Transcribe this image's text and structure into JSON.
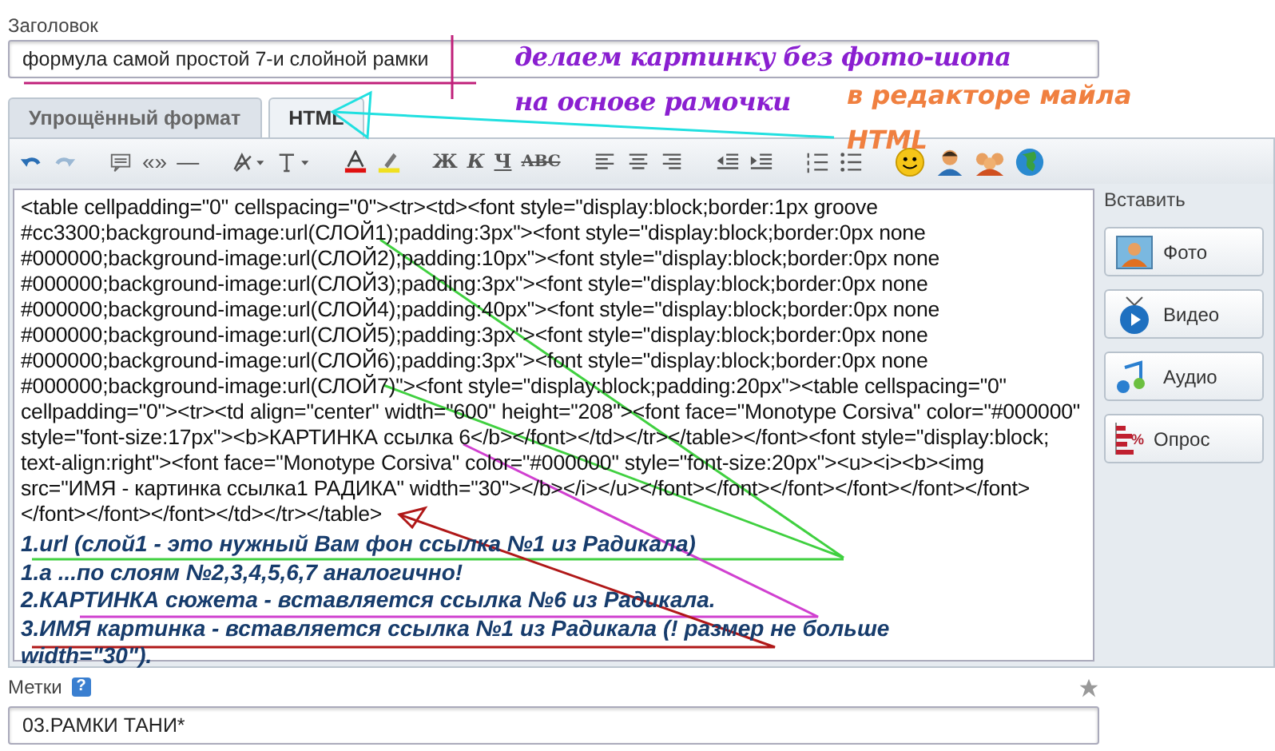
{
  "title_field": {
    "label": "Заголовок",
    "value": "формула самой простой 7-и слойной рамки"
  },
  "annotations": [
    {
      "kind": "main",
      "lines": [
        "делаем картинку без фото-шопа",
        "на основе рамочки"
      ]
    },
    {
      "kind": "side",
      "lines": [
        "в редакторе майла",
        "HTML"
      ]
    }
  ],
  "tabs": [
    {
      "label": "Упрощённый формат",
      "selected": false
    },
    {
      "label": "HTML",
      "selected": true
    }
  ],
  "toolbar": {
    "quote_glyph": "«»",
    "dash_glyph": "—",
    "format_buttons": [
      "Ж",
      "К",
      "Ч",
      "АВС"
    ]
  },
  "code_lines": [
    "<table cellpadding=\"0\" cellspacing=\"0\"><tr><td><font style=\"display:block;border:1px groove",
    "#cc3300;background-image:url(СЛОЙ1);padding:3px\"><font style=\"display:block;border:0px none",
    "#000000;background-image:url(СЛОЙ2);padding:10px\"><font style=\"display:block;border:0px none",
    "#000000;background-image:url(СЛОЙ3);padding:3px\"><font style=\"display:block;border:0px none",
    "#000000;background-image:url(СЛОЙ4);padding:40px\"><font style=\"display:block;border:0px none",
    "#000000;background-image:url(СЛОЙ5);padding:3px\"><font style=\"display:block;border:0px none",
    "#000000;background-image:url(СЛОЙ6);padding:3px\"><font style=\"display:block;border:0px none",
    "#000000;background-image:url(СЛОЙ7)\"><font style=\"display:block;padding:20px\"><table cellspacing=\"0\"",
    "cellpadding=\"0\"><tr><td align=\"center\" width=\"600\" height=\"208\"><font face=\"Monotype Corsiva\" color=\"#000000\"",
    "style=\"font-size:17px\"><b>КАРТИНКА ссылка 6</b></font></td></tr></table></font><font style=\"display:block;",
    "text-align:right\"><font face=\"Monotype Corsiva\" color=\"#000000\" style=\"font-size:20px\"><u><i><b><img",
    "src=\"ИМЯ - картинка ссылка1 РАДИКА\" width=\"30\"></b></i></u></font></font></font></font></font></font>",
    "</font></font></font></td></tr></table>"
  ],
  "notes": [
    "1.url (слой1 - это нужный Вам фон ссылка №1 из Радикала)",
    "1.а ...по слоям №2,3,4,5,6,7 аналогично!",
    "2.КАРТИНКА сюжета - вставляется ссылка №6 из Радикала.",
    "3.ИМЯ картинка - вставляется ссылка №1 из Радикала (! размер не больше width=\"30\")."
  ],
  "insert_panel": {
    "title": "Вставить",
    "buttons": [
      {
        "kind": "photo",
        "label": "Фото"
      },
      {
        "kind": "video",
        "label": "Видео"
      },
      {
        "kind": "audio",
        "label": "Аудио"
      },
      {
        "kind": "poll",
        "label": "Опрос",
        "icon_text": "%"
      }
    ]
  },
  "tags_field": {
    "label": "Метки",
    "help": "?",
    "value": "03.РАМКИ ТАНИ*"
  }
}
